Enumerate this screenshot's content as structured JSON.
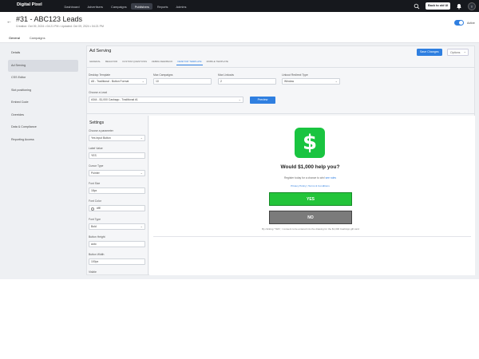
{
  "app": {
    "brand": "Digital Pixel"
  },
  "topnav": {
    "items": [
      "Dashboard",
      "Advertisers",
      "Campaigns",
      "Publishers",
      "Reports",
      "Admins"
    ],
    "active_index": 3,
    "back_label": "Back to old UI",
    "avatar_initial": "T",
    "icons": [
      "search-icon",
      "bell-icon"
    ]
  },
  "header": {
    "title": "#31 - ABC123 Leads",
    "meta": "Creation: Oct 09, 2024 • 04:21 PM • Updated: Oct 09, 2024 • 04:21 PM",
    "active_label": "Active",
    "active_state": true
  },
  "tabs": [
    "General",
    "Campaigns"
  ],
  "sidebar": {
    "items": [
      "Details",
      "Ad Serving",
      "CSS Editor",
      "Slot positioning",
      "Embed Code",
      "Overrides",
      "Data & Compliance",
      "Reporting Access"
    ],
    "active_index": 1
  },
  "panel": {
    "title": "Ad Serving",
    "save_label": "Save Changes",
    "options_label": "Options",
    "subtabs": [
      "GENERAL",
      "BEHAVIOR",
      "CUSTOM QUESTIONS",
      "ZEBRA FEEDBACK",
      "DESKTOP TEMPLATE",
      "MOBILE TEMPLATE"
    ],
    "active_subtab": 4
  },
  "form": {
    "desktop_template": {
      "label": "Desktop Template",
      "value": "A5 - Traditional - Button Format"
    },
    "max_campaigns": {
      "label": "Max Campaigns",
      "value": "10"
    },
    "max_linkouts": {
      "label": "Max Linkouts",
      "value": "2"
    },
    "linkout_redirect": {
      "label": "Linkout Redirect Type",
      "value": "Window"
    },
    "choose_lead": {
      "label": "Choose a Lead",
      "value": "#344 - $1,000 Cashapp - Traditional #1"
    },
    "preview_label": "Preview"
  },
  "settings": {
    "title": "Settings",
    "fields": [
      {
        "label": "Choose a parameter",
        "value": "Yes Input Button"
      },
      {
        "label": "Label Value",
        "value": "YES"
      },
      {
        "label": "Cursor Type",
        "value": "Pointer"
      },
      {
        "label": "Font Size",
        "value": "18px"
      },
      {
        "label": "Font Color",
        "value": "#fff"
      },
      {
        "label": "Font Type",
        "value": "Bold"
      },
      {
        "label": "Button Height",
        "value": "auto"
      },
      {
        "label": "Button Width",
        "value": "100px"
      },
      {
        "label": "Visible",
        "value": ""
      }
    ]
  },
  "preview": {
    "icon": "cashapp-dollar-icon",
    "icon_glyph": "$",
    "question": "Would $1,000 help you?",
    "subtext": "Register today for a chance to win!",
    "subtext_link": "see rules",
    "links": "Privacy Policy  |  Terms & Conditions",
    "yes_label": "YES",
    "no_label": "NO",
    "disclaimer": "By clicking \"YES\", I consent to be entered into the drawing for the $1,000 CashApp gift card",
    "yes_color": "#23c43a",
    "no_color": "#7b7b7b",
    "icon_color": "#19c440"
  },
  "colors": {
    "accent": "#2f7fe0",
    "nav_bg": "#16181d"
  }
}
